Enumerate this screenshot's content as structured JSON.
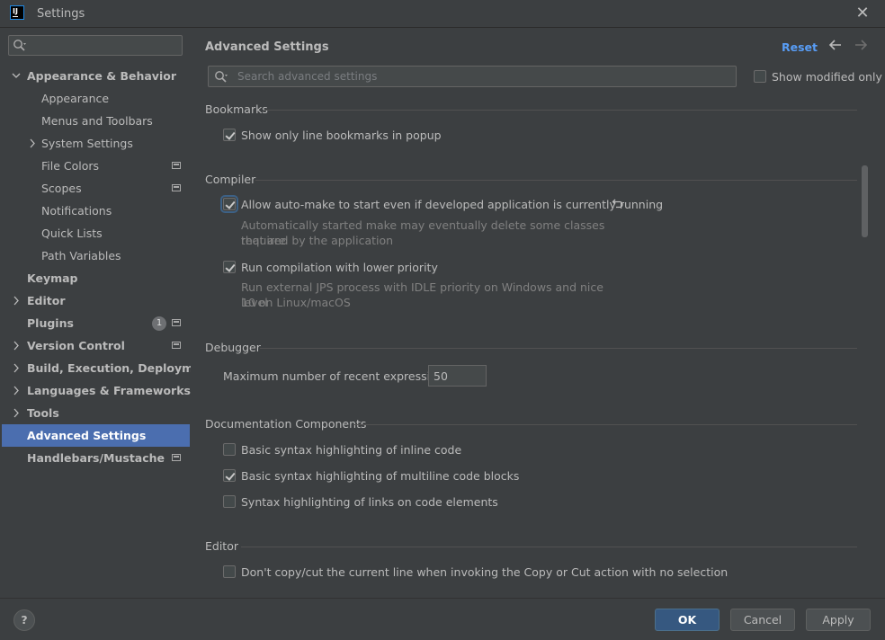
{
  "window": {
    "title": "Settings",
    "logo_text": "IJ"
  },
  "sidebar": {
    "search_placeholder": "",
    "items": [
      {
        "label": "Appearance & Behavior",
        "level": 0,
        "expanded": true
      },
      {
        "label": "Appearance",
        "level": 1
      },
      {
        "label": "Menus and Toolbars",
        "level": 1
      },
      {
        "label": "System Settings",
        "level": 1,
        "collapsed": true
      },
      {
        "label": "File Colors",
        "level": 1
      },
      {
        "label": "Scopes",
        "level": 1
      },
      {
        "label": "Notifications",
        "level": 1
      },
      {
        "label": "Quick Lists",
        "level": 1
      },
      {
        "label": "Path Variables",
        "level": 1
      },
      {
        "label": "Keymap",
        "level": 0
      },
      {
        "label": "Editor",
        "level": 0,
        "collapsed": true
      },
      {
        "label": "Plugins",
        "level": 0,
        "badge": "1"
      },
      {
        "label": "Version Control",
        "level": 0,
        "collapsed": true
      },
      {
        "label": "Build, Execution, Deployment",
        "level": 0,
        "collapsed": true
      },
      {
        "label": "Languages & Frameworks",
        "level": 0,
        "collapsed": true
      },
      {
        "label": "Tools",
        "level": 0,
        "collapsed": true
      },
      {
        "label": "Advanced Settings",
        "level": 0,
        "selected": true
      },
      {
        "label": "Handlebars/Mustache",
        "level": 0
      }
    ]
  },
  "main": {
    "title": "Advanced Settings",
    "reset_label": "Reset",
    "search_placeholder": "Search advanced settings",
    "show_modified_label": "Show modified only",
    "show_modified_checked": false,
    "sections": {
      "bookmarks": {
        "title": "Bookmarks",
        "opt1": {
          "label": "Show only line bookmarks in popup",
          "checked": true
        }
      },
      "compiler": {
        "title": "Compiler",
        "opt1": {
          "label": "Allow auto-make to start even if developed application is currently running",
          "checked": true,
          "desc_line1": "Automatically started make may eventually delete some classes that are",
          "desc_line2": "required by the application"
        },
        "opt2": {
          "label": "Run compilation with lower priority",
          "checked": true,
          "desc_line1": "Run external JPS process with IDLE priority on Windows and nice level",
          "desc_line2": "10 on Linux/macOS"
        }
      },
      "debugger": {
        "title": "Debugger",
        "max_expr_label": "Maximum number of recent expressions:",
        "max_expr_value": "50"
      },
      "doc_components": {
        "title": "Documentation Components",
        "opt1": {
          "label": "Basic syntax highlighting of inline code",
          "checked": false
        },
        "opt2": {
          "label": "Basic syntax highlighting of multiline code blocks",
          "checked": true
        },
        "opt3": {
          "label": "Syntax highlighting of links on code elements",
          "checked": false
        }
      },
      "editor": {
        "title": "Editor",
        "opt1": {
          "label": "Don't copy/cut the current line when invoking the Copy or Cut action with no selection",
          "checked": false
        }
      }
    }
  },
  "footer": {
    "help_label": "?",
    "ok_label": "OK",
    "cancel_label": "Cancel",
    "apply_label": "Apply"
  },
  "colors": {
    "background": "#3c3f41",
    "selection": "#4b6eaf",
    "link": "#589df6",
    "primary_button": "#365880"
  }
}
